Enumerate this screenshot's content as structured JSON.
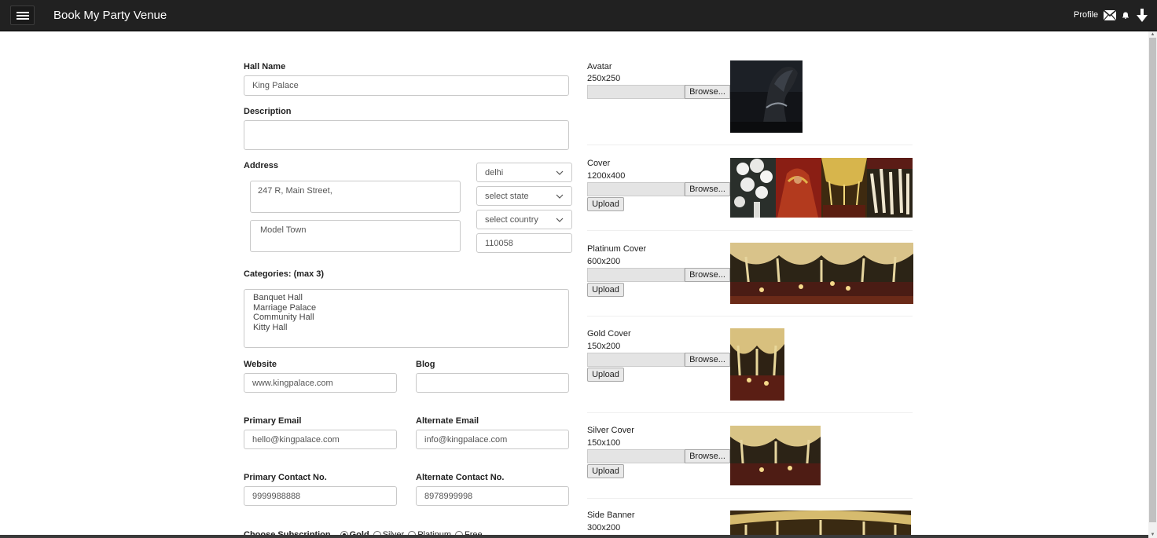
{
  "app": {
    "title": "Book My Party Venue",
    "profile_label": "Profile",
    "icons": [
      "menu-icon",
      "mail-icon",
      "bell-icon",
      "download-arrow-icon"
    ]
  },
  "form": {
    "hall_name_label": "Hall Name",
    "hall_name_value": "King Palace",
    "description_label": "Description",
    "description_value": "",
    "address_label": "Address",
    "address_line1": "247 R, Main Street,",
    "address_line2": "Model Town",
    "city": "delhi",
    "state": "select state",
    "country": "select country",
    "pincode": "110058",
    "categories_label": "Categories: (max 3)",
    "categories": [
      "Banquet Hall",
      "Marriage Palace",
      "Community Hall",
      "Kitty Hall"
    ],
    "website_label": "Website",
    "website_value": "www.kingpalace.com",
    "blog_label": "Blog",
    "blog_value": "",
    "primary_email_label": "Primary Email",
    "primary_email_value": "hello@kingpalace.com",
    "alternate_email_label": "Alternate Email",
    "alternate_email_value": "info@kingpalace.com",
    "primary_contact_label": "Primary Contact No.",
    "primary_contact_value": "9999988888",
    "alternate_contact_label": "Alternate Contact No.",
    "alternate_contact_value": "8978999998",
    "subscription_label": "Choose Subscription",
    "subscription_options": [
      "Gold",
      "Silver",
      "Platinum",
      "Free"
    ],
    "subscription_selected": "Gold"
  },
  "images": {
    "browse_label": "Browse...",
    "upload_label": "Upload",
    "avatar": {
      "title": "Avatar",
      "size": "250x250"
    },
    "cover": {
      "title": "Cover",
      "size": "1200x400"
    },
    "platinum": {
      "title": "Platinum Cover",
      "size": "600x200"
    },
    "gold": {
      "title": "Gold Cover",
      "size": "150x200"
    },
    "silver": {
      "title": "Silver Cover",
      "size": "150x100"
    },
    "side_banner": {
      "title": "Side Banner",
      "size": "300x200"
    }
  },
  "colors": {
    "topbar": "#212121",
    "border": "#c9c9c9",
    "button": "#e9e9e9"
  }
}
